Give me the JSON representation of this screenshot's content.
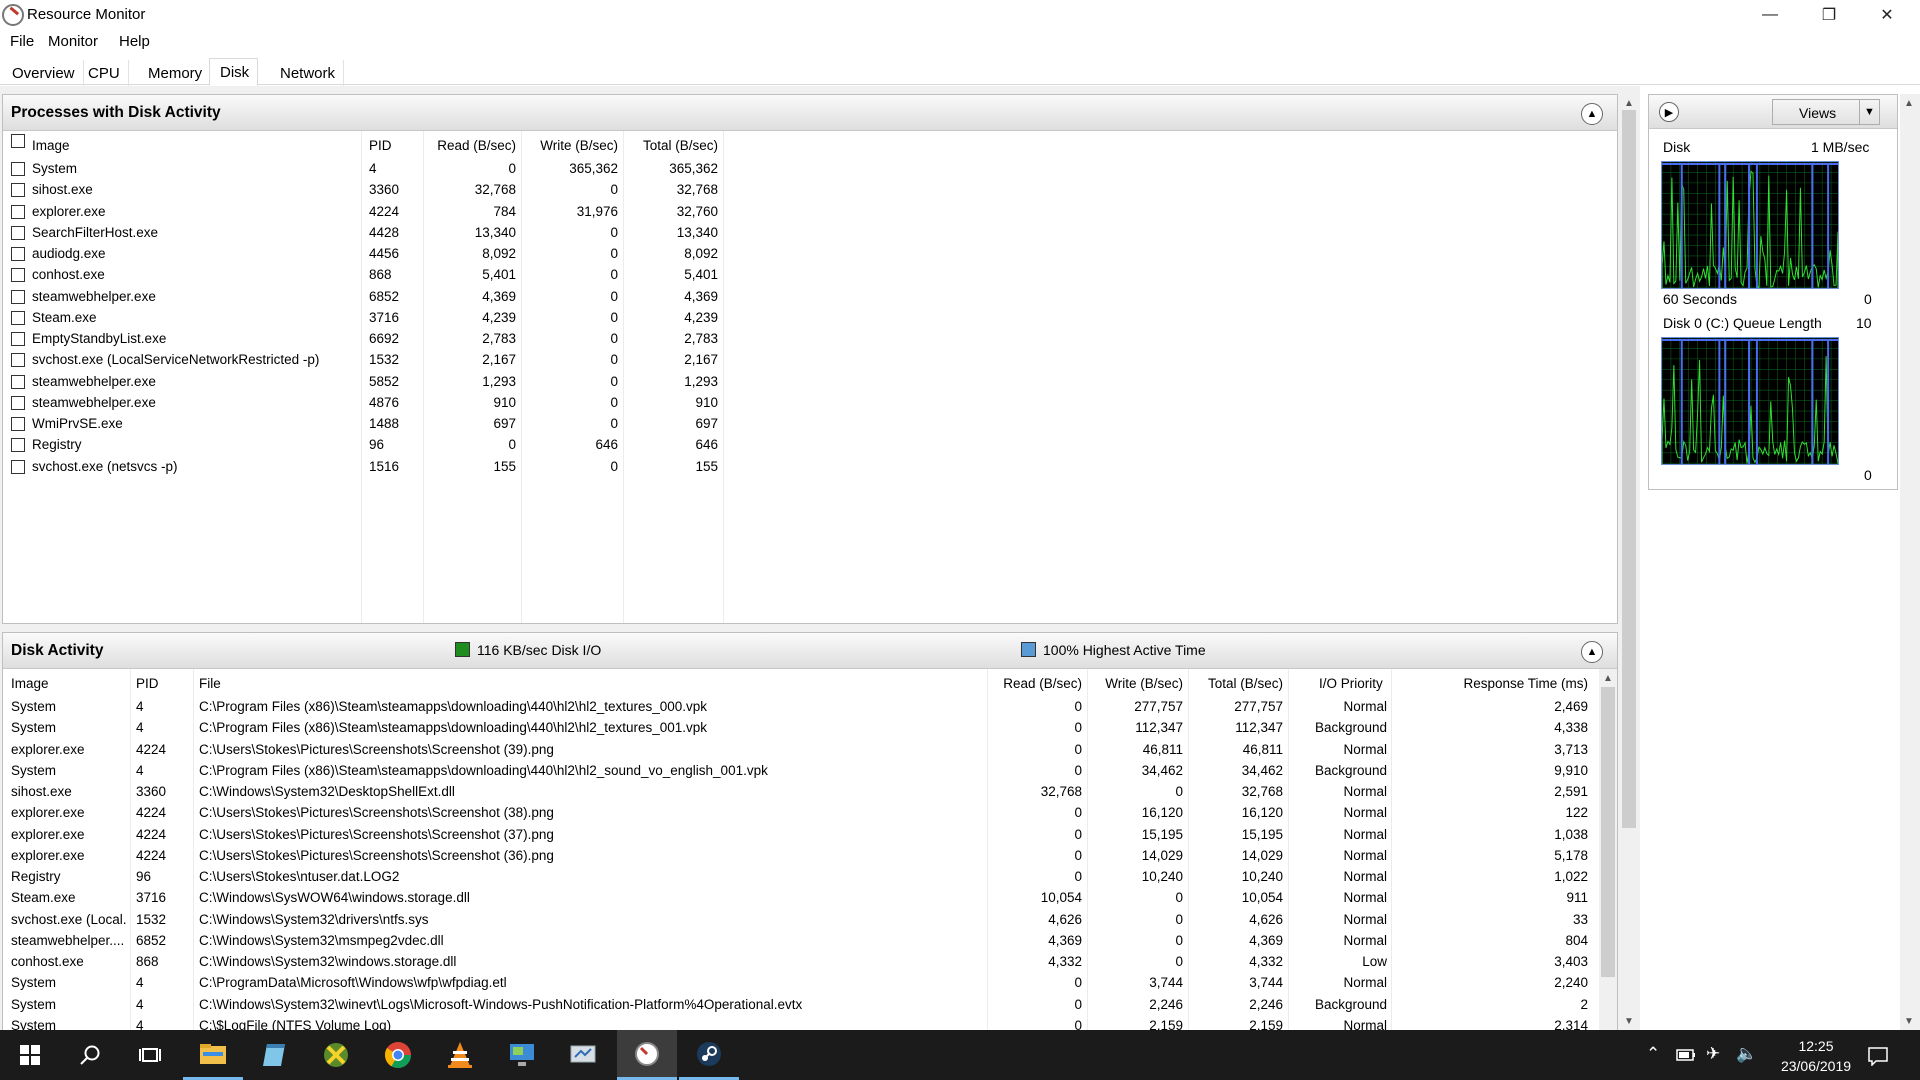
{
  "window": {
    "title": "Resource Monitor"
  },
  "menus": [
    "File",
    "Monitor",
    "Help"
  ],
  "tabs": [
    "Overview",
    "CPU",
    "Memory",
    "Disk",
    "Network"
  ],
  "processes": {
    "title": "Processes with Disk Activity",
    "columns": [
      "Image",
      "PID",
      "Read (B/sec)",
      "Write (B/sec)",
      "Total (B/sec)"
    ],
    "rows": [
      [
        "System",
        "4",
        "0",
        "365,362",
        "365,362"
      ],
      [
        "sihost.exe",
        "3360",
        "32,768",
        "0",
        "32,768"
      ],
      [
        "explorer.exe",
        "4224",
        "784",
        "31,976",
        "32,760"
      ],
      [
        "SearchFilterHost.exe",
        "4428",
        "13,340",
        "0",
        "13,340"
      ],
      [
        "audiodg.exe",
        "4456",
        "8,092",
        "0",
        "8,092"
      ],
      [
        "conhost.exe",
        "868",
        "5,401",
        "0",
        "5,401"
      ],
      [
        "steamwebhelper.exe",
        "6852",
        "4,369",
        "0",
        "4,369"
      ],
      [
        "Steam.exe",
        "3716",
        "4,239",
        "0",
        "4,239"
      ],
      [
        "EmptyStandbyList.exe",
        "6692",
        "2,783",
        "0",
        "2,783"
      ],
      [
        "svchost.exe (LocalServiceNetworkRestricted -p)",
        "1532",
        "2,167",
        "0",
        "2,167"
      ],
      [
        "steamwebhelper.exe",
        "5852",
        "1,293",
        "0",
        "1,293"
      ],
      [
        "steamwebhelper.exe",
        "4876",
        "910",
        "0",
        "910"
      ],
      [
        "WmiPrvSE.exe",
        "1488",
        "697",
        "0",
        "697"
      ],
      [
        "Registry",
        "96",
        "0",
        "646",
        "646"
      ],
      [
        "svchost.exe (netsvcs -p)",
        "1516",
        "155",
        "0",
        "155"
      ]
    ]
  },
  "disk_activity": {
    "title": "Disk Activity",
    "legend_io": "116 KB/sec Disk I/O",
    "legend_active": "100% Highest Active Time",
    "io_color": "#1e8c1e",
    "active_color": "#5b9bd5",
    "columns": [
      "Image",
      "PID",
      "File",
      "Read (B/sec)",
      "Write (B/sec)",
      "Total (B/sec)",
      "I/O Priority",
      "Response Time (ms)"
    ],
    "rows": [
      [
        "System",
        "4",
        "C:\\Program Files (x86)\\Steam\\steamapps\\downloading\\440\\hl2\\hl2_textures_000.vpk",
        "0",
        "277,757",
        "277,757",
        "Normal",
        "2,469"
      ],
      [
        "System",
        "4",
        "C:\\Program Files (x86)\\Steam\\steamapps\\downloading\\440\\hl2\\hl2_textures_001.vpk",
        "0",
        "112,347",
        "112,347",
        "Background",
        "4,338"
      ],
      [
        "explorer.exe",
        "4224",
        "C:\\Users\\Stokes\\Pictures\\Screenshots\\Screenshot (39).png",
        "0",
        "46,811",
        "46,811",
        "Normal",
        "3,713"
      ],
      [
        "System",
        "4",
        "C:\\Program Files (x86)\\Steam\\steamapps\\downloading\\440\\hl2\\hl2_sound_vo_english_001.vpk",
        "0",
        "34,462",
        "34,462",
        "Background",
        "9,910"
      ],
      [
        "sihost.exe",
        "3360",
        "C:\\Windows\\System32\\DesktopShellExt.dll",
        "32,768",
        "0",
        "32,768",
        "Normal",
        "2,591"
      ],
      [
        "explorer.exe",
        "4224",
        "C:\\Users\\Stokes\\Pictures\\Screenshots\\Screenshot (38).png",
        "0",
        "16,120",
        "16,120",
        "Normal",
        "122"
      ],
      [
        "explorer.exe",
        "4224",
        "C:\\Users\\Stokes\\Pictures\\Screenshots\\Screenshot (37).png",
        "0",
        "15,195",
        "15,195",
        "Normal",
        "1,038"
      ],
      [
        "explorer.exe",
        "4224",
        "C:\\Users\\Stokes\\Pictures\\Screenshots\\Screenshot (36).png",
        "0",
        "14,029",
        "14,029",
        "Normal",
        "5,178"
      ],
      [
        "Registry",
        "96",
        "C:\\Users\\Stokes\\ntuser.dat.LOG2",
        "0",
        "10,240",
        "10,240",
        "Normal",
        "1,022"
      ],
      [
        "Steam.exe",
        "3716",
        "C:\\Windows\\SysWOW64\\windows.storage.dll",
        "10,054",
        "0",
        "10,054",
        "Normal",
        "911"
      ],
      [
        "svchost.exe (Local...",
        "1532",
        "C:\\Windows\\System32\\drivers\\ntfs.sys",
        "4,626",
        "0",
        "4,626",
        "Normal",
        "33"
      ],
      [
        "steamwebhelper....",
        "6852",
        "C:\\Windows\\System32\\msmpeg2vdec.dll",
        "4,369",
        "0",
        "4,369",
        "Normal",
        "804"
      ],
      [
        "conhost.exe",
        "868",
        "C:\\Windows\\System32\\windows.storage.dll",
        "4,332",
        "0",
        "4,332",
        "Low",
        "3,403"
      ],
      [
        "System",
        "4",
        "C:\\ProgramData\\Microsoft\\Windows\\wfp\\wfpdiag.etl",
        "0",
        "3,744",
        "3,744",
        "Normal",
        "2,240"
      ],
      [
        "System",
        "4",
        "C:\\Windows\\System32\\winevt\\Logs\\Microsoft-Windows-PushNotification-Platform%4Operational.evtx",
        "0",
        "2,246",
        "2,246",
        "Background",
        "2"
      ],
      [
        "System",
        "4",
        "C:\\$LogFile (NTFS Volume Log)",
        "0",
        "2,159",
        "2,159",
        "Normal",
        "2,314"
      ]
    ]
  },
  "sidebar": {
    "views_label": "Views",
    "disk_graph": {
      "label": "Disk",
      "scale": "1 MB/sec",
      "time_label": "60 Seconds",
      "min": "0"
    },
    "queue_graph": {
      "label": "Disk 0 (C:) Queue Length",
      "scale": "10",
      "min": "0"
    }
  },
  "taskbar": {
    "time": "12:25",
    "date": "23/06/2019"
  }
}
